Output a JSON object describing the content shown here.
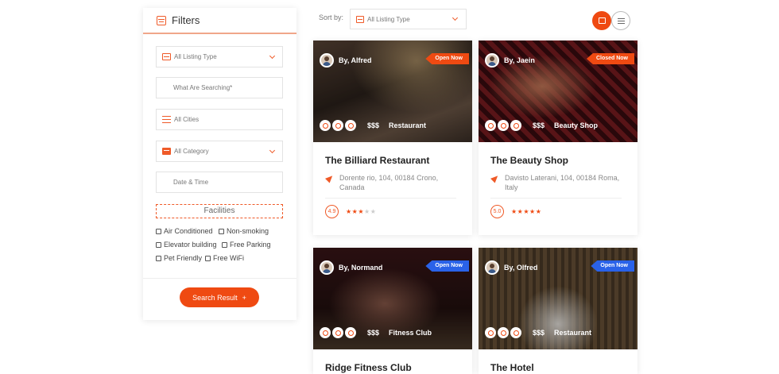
{
  "filters": {
    "title": "Filters",
    "listing_type": "All Listing Type",
    "search_placeholder": "What Are Searching*",
    "cities": "All Cities",
    "category": "All Category",
    "date_time": "Date & Time",
    "facilities_label": "Facilities",
    "facilities": [
      "Air Conditioned",
      "Non-smoking",
      "Elevator building",
      "Free Parking",
      "Pet Friendly",
      "Free WiFi"
    ],
    "search_button": "Search Result",
    "search_button_icon": "+"
  },
  "sort": {
    "label": "Sort by:",
    "value": "All Listing Type"
  },
  "view": {
    "grid_icon": "grid-view-icon",
    "list_icon": "list-view-icon",
    "active": "grid"
  },
  "listings": [
    {
      "author": "By, Alfred",
      "status": "Open Now",
      "status_color": "#ef4a12",
      "price": "$$$",
      "category": "Restaurant",
      "title": "The Billiard Restaurant",
      "address": "Dorente rio, 104, 00184 Crono, Canada",
      "rating": "4.9",
      "stars": 3
    },
    {
      "author": "By, Jaein",
      "status": "Closed Now",
      "status_color": "#ef4a12",
      "price": "$$$",
      "category": "Beauty Shop",
      "title": "The Beauty Shop",
      "address": "Davisto Laterani, 104, 00184 Roma, Italy",
      "rating": "5.0",
      "stars": 5
    },
    {
      "author": "By, Normand",
      "status": "Open Now",
      "status_color": "#2a62e8",
      "price": "$$$",
      "category": "Fitness Club",
      "title": "Ridge Fitness Club"
    },
    {
      "author": "By, Olfred",
      "status": "Open Now",
      "status_color": "#2a62e8",
      "price": "$$$",
      "category": "Restaurant",
      "title": "The Hotel"
    }
  ],
  "colors": {
    "accent": "#ef4a12",
    "badge_blue": "#2a62e8"
  }
}
